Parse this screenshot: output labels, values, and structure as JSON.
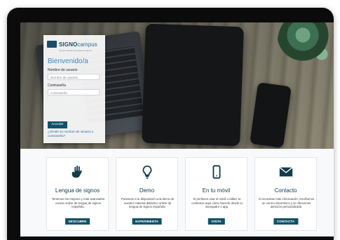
{
  "colors": {
    "primary": "#0f5269",
    "link": "#2d6ea8",
    "welcome": "#3b89c9",
    "bezel": "#0b0b0c"
  },
  "login": {
    "brand_main": "SIGNO",
    "brand_sub": "campus",
    "tagline": "campus virtual de lengua de signos",
    "welcome": "Bienvenido/a",
    "username_label": "Nombre de usuario",
    "username_placeholder": "Nombre de usuario",
    "password_label": "Contraseña",
    "password_placeholder": "Contraseña",
    "submit_label": "Acceder",
    "forgot_text": "¿Olvidó su nombre de usuario o contraseña?"
  },
  "features": [
    {
      "icon": "sign-language-hands-icon",
      "title": "Lengua de signos",
      "description": "Tenemos los mejores y más avanzados cursos online de lengua de signos española.",
      "cta": "DESCUBRE"
    },
    {
      "icon": "lightbulb-icon",
      "title": "Demo",
      "description": "Ponemos a tu disposición una demo de nuestro material didáctico online de lengua de signos española.",
      "cta": "EXPERIMENTA"
    },
    {
      "icon": "mobile-phone-icon",
      "title": "En tu móvil",
      "description": "Si prefieres usar el móvil o tablet, te contamos aquí cómo hacerlo desde tu navegador o app.",
      "cta": "VISITA"
    },
    {
      "icon": "envelope-icon",
      "title": "Contacto",
      "description": "Si necesitas más información, escríbenos un correo electrónico y te ofrecemos atención personalizada.",
      "cta": "CONTACTA"
    }
  ]
}
